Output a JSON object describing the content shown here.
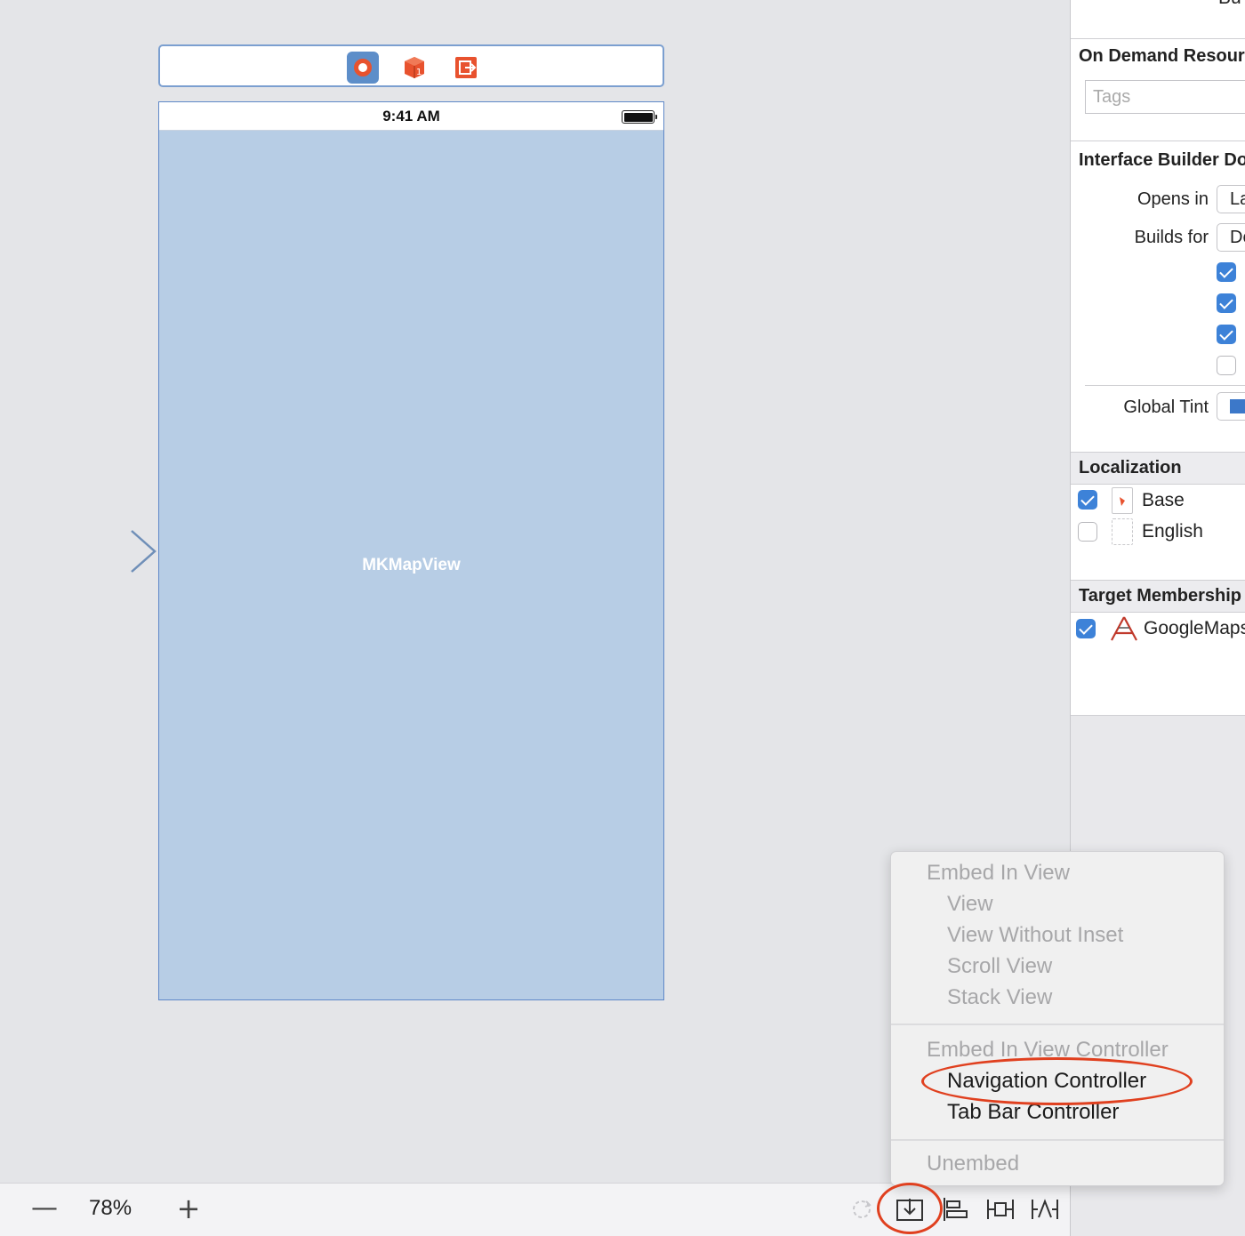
{
  "canvas": {
    "status_time": "9:41 AM",
    "map_label": "MKMapView",
    "dock_icons": [
      "view-controller-icon",
      "first-responder-icon",
      "exit-icon"
    ]
  },
  "inspector": {
    "header_fragment": "Bu",
    "on_demand": {
      "title": "On Demand Resources",
      "tags_placeholder": "Tags"
    },
    "ib_document": {
      "title": "Interface Builder Document",
      "opens_in_label": "Opens in",
      "opens_in_value": "Latest Xcode",
      "builds_for_label": "Builds for",
      "builds_for_value": "Deployment Target",
      "checkboxes": [
        true,
        true,
        true,
        false
      ],
      "global_tint_label": "Global Tint",
      "global_tint_color": "#3c78c9"
    },
    "localization": {
      "title": "Localization",
      "items": [
        {
          "label": "Base",
          "checked": true
        },
        {
          "label": "English",
          "checked": false
        }
      ]
    },
    "target_membership": {
      "title": "Target Membership",
      "items": [
        {
          "label": "GoogleMaps",
          "checked": true
        }
      ]
    }
  },
  "bottom_bar": {
    "zoom_out": "—",
    "zoom_level": "78%",
    "zoom_in": "+",
    "icons": [
      "update-frames-icon",
      "embed-in-icon",
      "align-icon",
      "pin-icon",
      "resolve-autolayout-icon"
    ]
  },
  "embed_menu": {
    "section1_header": "Embed In View",
    "section1_items": [
      "View",
      "View Without Inset",
      "Scroll View",
      "Stack View"
    ],
    "section2_header": "Embed In View Controller",
    "section2_items": [
      "Navigation Controller",
      "Tab Bar Controller"
    ],
    "unembed": "Unembed"
  },
  "colors": {
    "highlight": "#e0401f",
    "map_fill": "#b7cde5",
    "accent": "#3d82d8"
  }
}
